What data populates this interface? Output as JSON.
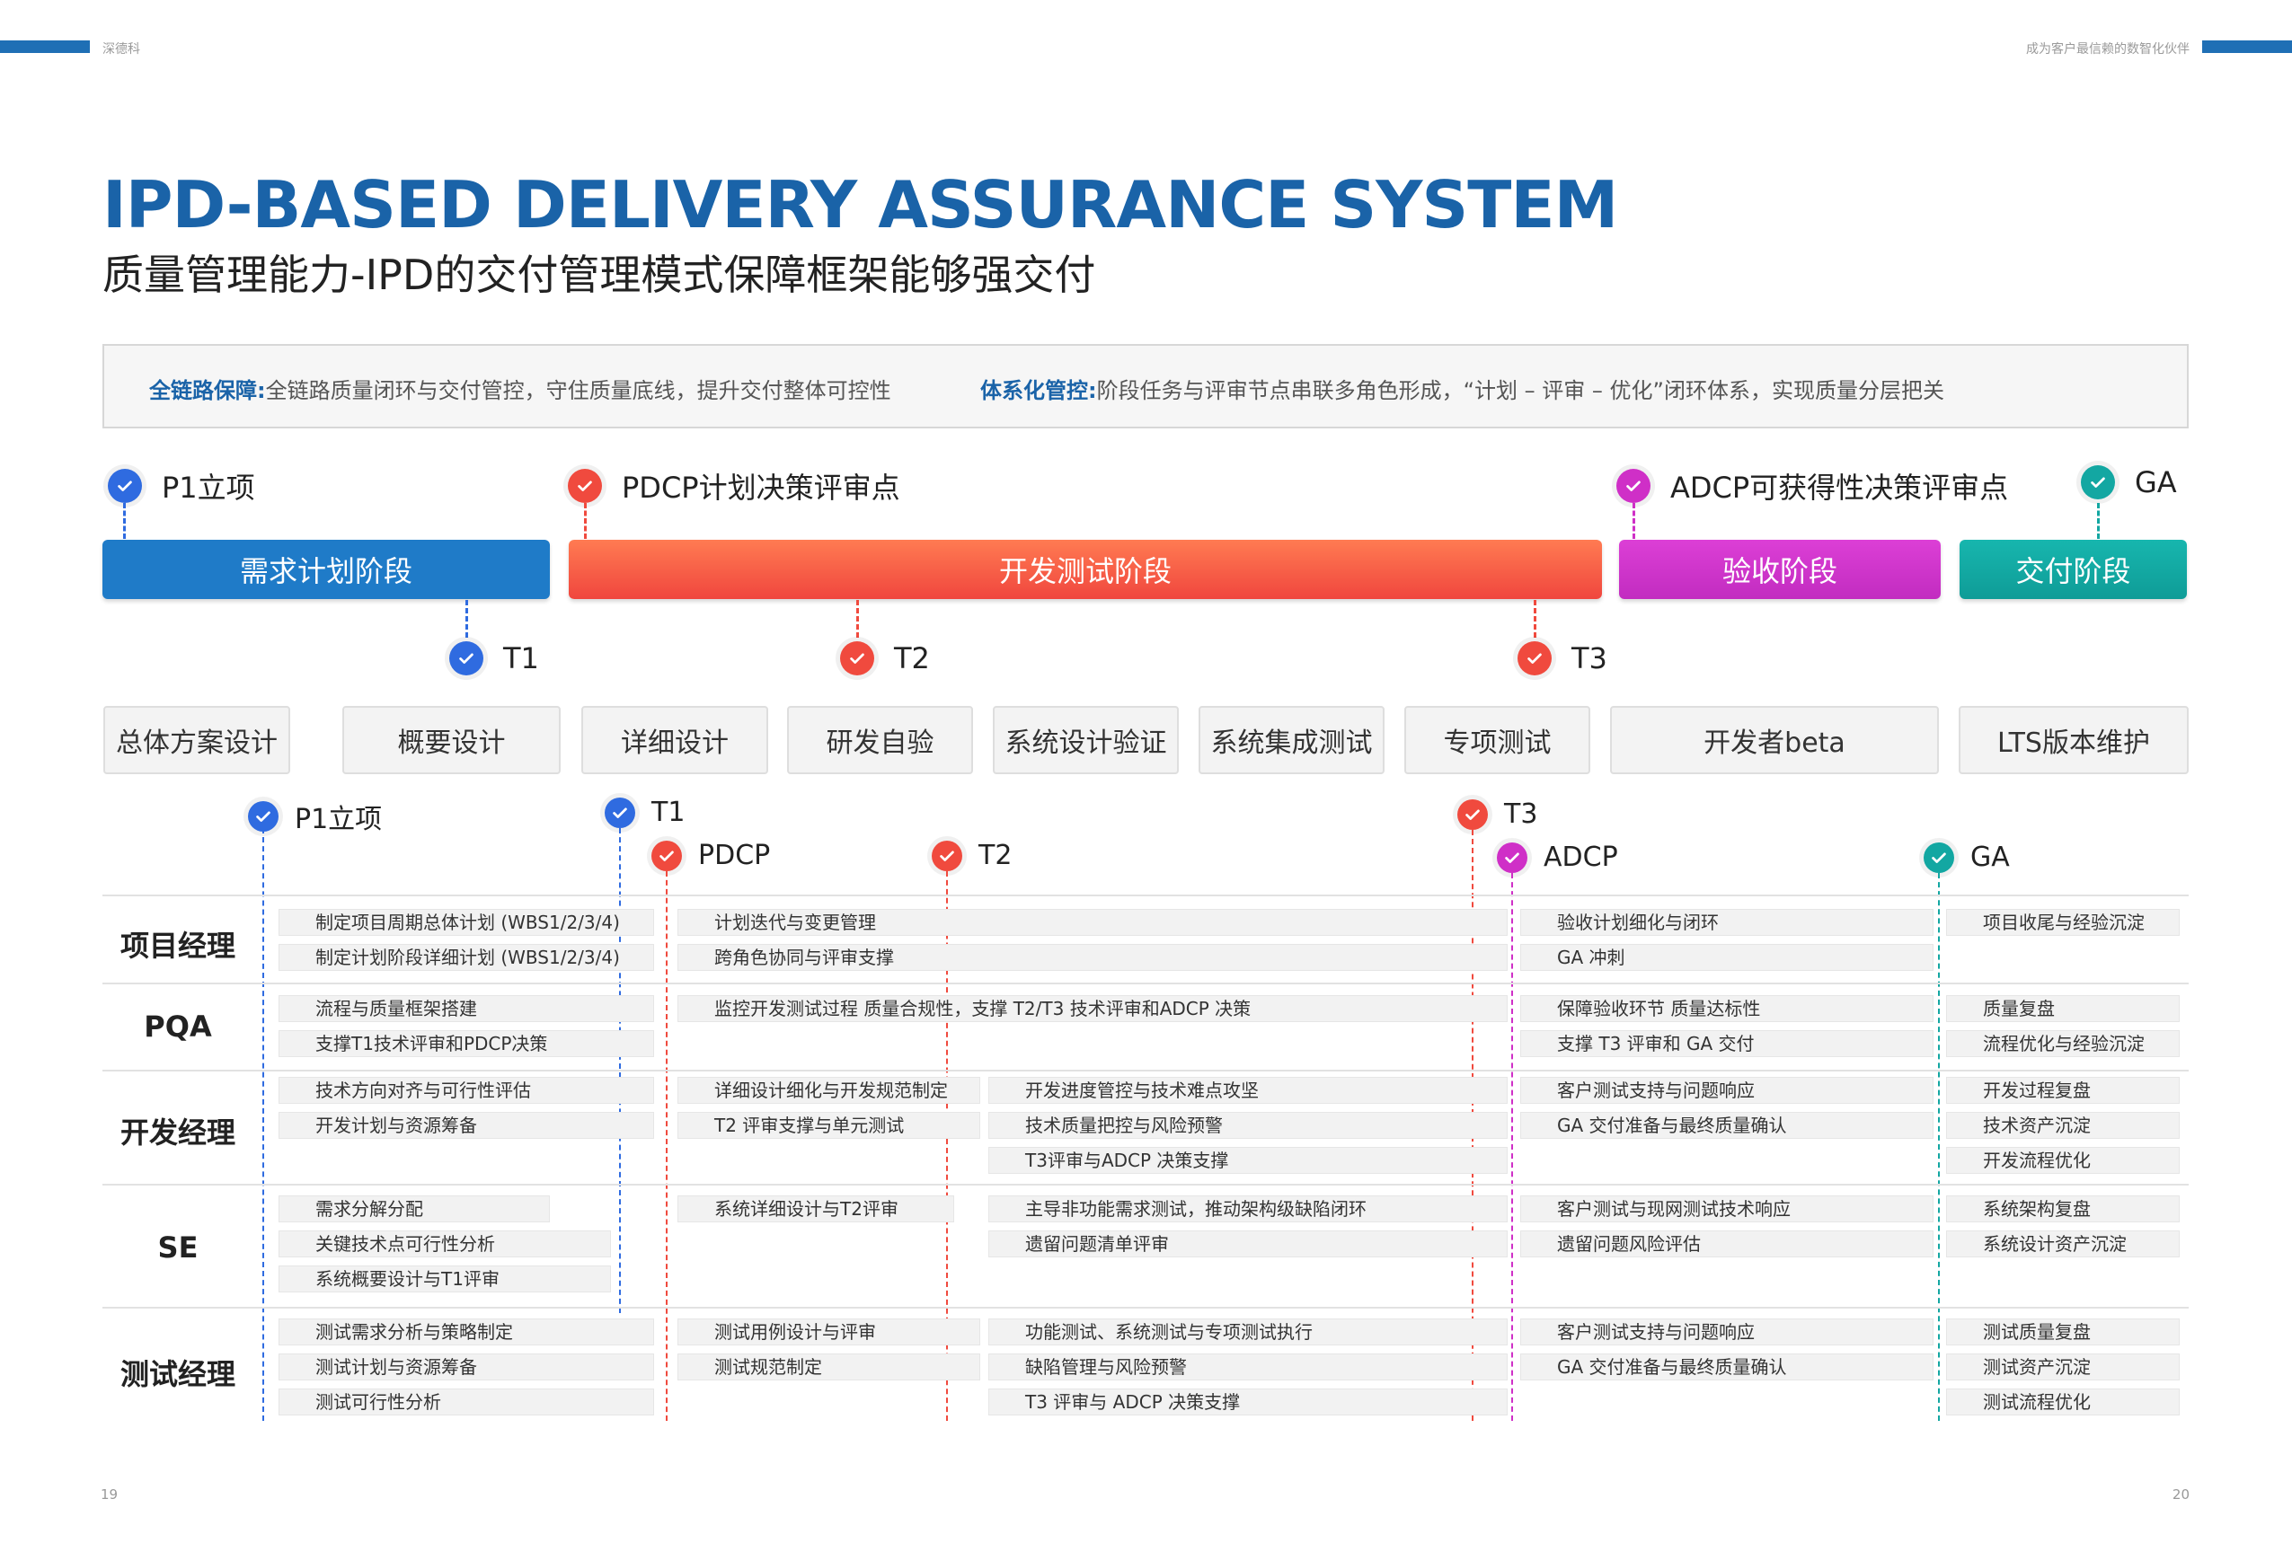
{
  "header": {
    "brand": "深德科",
    "slogan": "成为客户最信赖的数智化伙伴"
  },
  "title_en": "IPD-BASED DELIVERY ASSURANCE SYSTEM",
  "title_cn": "质量管理能力-IPD的交付管理模式保障框架能够强交付",
  "info": {
    "k1": "全链路保障:",
    "v1": "全链路质量闭环与交付管控，守住质量底线，提升交付整体可控性",
    "k2": "体系化管控:",
    "v2": "阶段任务与评审节点串联多角色形成，“计划 – 评审 – 优化”闭环体系，实现质量分层把关"
  },
  "colors": {
    "blue": "#1f7bc8",
    "red": "#f04a3e",
    "magenta": "#cf2fc7",
    "teal": "#13a7a2",
    "check_blue": "#2f6be0"
  },
  "top_milestones": {
    "p1": "P1立项",
    "pdcp": "PDCP计划决策评审点",
    "adcp": "ADCP可获得性决策评审点",
    "ga": "GA"
  },
  "phases": {
    "p1": "需求计划阶段",
    "p2": "开发测试阶段",
    "p3": "验收阶段",
    "p4": "交付阶段"
  },
  "t_milestones": {
    "t1": "T1",
    "t2": "T2",
    "t3": "T3"
  },
  "steps": [
    "总体方案设计",
    "概要设计",
    "详细设计",
    "研发自验",
    "系统设计验证",
    "系统集成测试",
    "专项测试",
    "开发者beta",
    "LTS版本维护"
  ],
  "lower_milestones": {
    "p1": "P1立项",
    "t1": "T1",
    "pdcp": "PDCP",
    "t2": "T2",
    "t3": "T3",
    "adcp": "ADCP",
    "ga": "GA"
  },
  "roles": {
    "pm": {
      "name": "项目经理",
      "c1": [
        "制定项目周期总体计划 (WBS1/2/3/4)",
        "制定计划阶段详细计划 (WBS1/2/3/4)"
      ],
      "c2": [
        "计划迭代与变更管理",
        "跨角色协同与评审支撑"
      ],
      "c4": [
        "验收计划细化与闭环",
        "GA 冲刺"
      ],
      "c5": [
        "项目收尾与经验沉淀"
      ]
    },
    "pqa": {
      "name": "PQA",
      "c1": [
        "流程与质量框架搭建",
        "支撑T1技术评审和PDCP决策"
      ],
      "c2": [
        "监控开发测试过程 质量合规性，支撑 T2/T3 技术评审和ADCP 决策"
      ],
      "c4": [
        "保障验收环节 质量达标性",
        "支撑 T3 评审和 GA 交付"
      ],
      "c5": [
        "质量复盘",
        "流程优化与经验沉淀"
      ]
    },
    "dev": {
      "name": "开发经理",
      "c1": [
        "技术方向对齐与可行性评估",
        "开发计划与资源筹备"
      ],
      "c2": [
        "详细设计细化与开发规范制定",
        "T2 评审支撑与单元测试"
      ],
      "c3": [
        "开发进度管控与技术难点攻坚",
        "技术质量把控与风险预警",
        "T3评审与ADCP 决策支撑"
      ],
      "c4": [
        "客户测试支持与问题响应",
        "GA 交付准备与最终质量确认"
      ],
      "c5": [
        "开发过程复盘",
        "技术资产沉淀",
        "开发流程优化"
      ]
    },
    "se": {
      "name": "SE",
      "c1": [
        "需求分解分配",
        "关键技术点可行性分析",
        "系统概要设计与T1评审"
      ],
      "c2": [
        "系统详细设计与T2评审"
      ],
      "c3": [
        "主导非功能需求测试，推动架构级缺陷闭环",
        "遗留问题清单评审"
      ],
      "c4": [
        "客户测试与现网测试技术响应",
        "遗留问题风险评估"
      ],
      "c5": [
        "系统架构复盘",
        "系统设计资产沉淀"
      ]
    },
    "test": {
      "name": "测试经理",
      "c1": [
        "测试需求分析与策略制定",
        "测试计划与资源筹备",
        "测试可行性分析"
      ],
      "c2": [
        "测试用例设计与评审",
        "测试规范制定"
      ],
      "c3": [
        "功能测试、系统测试与专项测试执行",
        "缺陷管理与风险预警",
        "T3 评审与 ADCP 决策支撑"
      ],
      "c4": [
        "客户测试支持与问题响应",
        "GA 交付准备与最终质量确认"
      ],
      "c5": [
        "测试质量复盘",
        "测试资产沉淀",
        "测试流程优化"
      ]
    }
  },
  "page_numbers": {
    "left": "19",
    "right": "20"
  }
}
